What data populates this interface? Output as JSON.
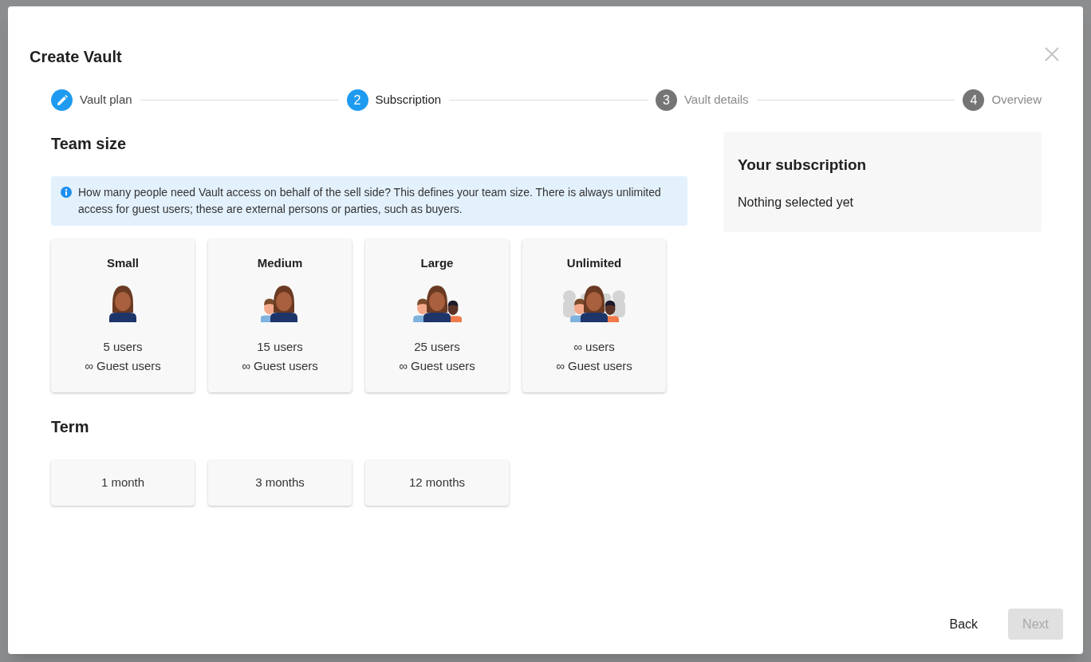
{
  "dialog": {
    "title": "Create Vault"
  },
  "steps": [
    {
      "label": "Vault plan",
      "completed": true,
      "selected": false
    },
    {
      "number": "2",
      "label": "Subscription",
      "completed": false,
      "selected": true
    },
    {
      "number": "3",
      "label": "Vault details",
      "completed": false,
      "selected": false
    },
    {
      "number": "4",
      "label": "Overview",
      "completed": false,
      "selected": false
    }
  ],
  "team_size": {
    "heading": "Team size",
    "info": "How many people need Vault access on behalf of the sell side? This defines your team size. There is always unlimited access for guest users; these are external persons or parties, such as buyers.",
    "options": [
      {
        "title": "Small",
        "kind": "one",
        "users": "5 users",
        "guests": "∞ Guest users",
        "selected": false
      },
      {
        "title": "Medium",
        "kind": "two",
        "users": "15 users",
        "guests": "∞ Guest users",
        "selected": false
      },
      {
        "title": "Large",
        "kind": "three",
        "users": "25 users",
        "guests": "∞ Guest users",
        "selected": false
      },
      {
        "title": "Unlimited",
        "kind": "crowd",
        "users": "∞ users",
        "guests": "∞ Guest users",
        "selected": false
      }
    ]
  },
  "term": {
    "heading": "Term",
    "options": [
      {
        "label": "1 month",
        "selected": false
      },
      {
        "label": "3 months",
        "selected": false
      },
      {
        "label": "12 months",
        "selected": false
      }
    ]
  },
  "summary": {
    "title": "Your subscription",
    "text": "Nothing selected yet"
  },
  "buttons": [
    {
      "label": "Back",
      "kind": "text",
      "disabled": false
    },
    {
      "label": "Next",
      "kind": "primary",
      "disabled": true
    }
  ]
}
